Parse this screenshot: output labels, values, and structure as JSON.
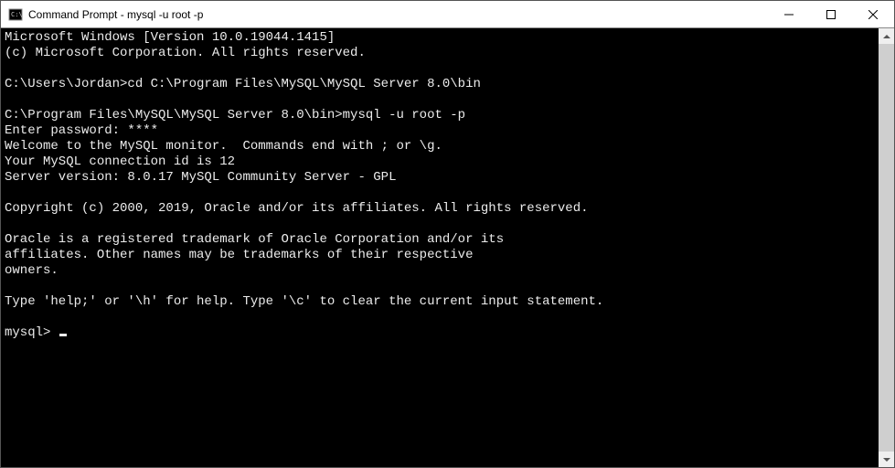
{
  "titlebar": {
    "title": "Command Prompt - mysql  -u root -p"
  },
  "terminal": {
    "lines": [
      "Microsoft Windows [Version 10.0.19044.1415]",
      "(c) Microsoft Corporation. All rights reserved.",
      "",
      "C:\\Users\\Jordan>cd C:\\Program Files\\MySQL\\MySQL Server 8.0\\bin",
      "",
      "C:\\Program Files\\MySQL\\MySQL Server 8.0\\bin>mysql -u root -p",
      "Enter password: ****",
      "Welcome to the MySQL monitor.  Commands end with ; or \\g.",
      "Your MySQL connection id is 12",
      "Server version: 8.0.17 MySQL Community Server - GPL",
      "",
      "Copyright (c) 2000, 2019, Oracle and/or its affiliates. All rights reserved.",
      "",
      "Oracle is a registered trademark of Oracle Corporation and/or its",
      "affiliates. Other names may be trademarks of their respective",
      "owners.",
      "",
      "Type 'help;' or '\\h' for help. Type '\\c' to clear the current input statement.",
      ""
    ],
    "prompt": "mysql> "
  }
}
